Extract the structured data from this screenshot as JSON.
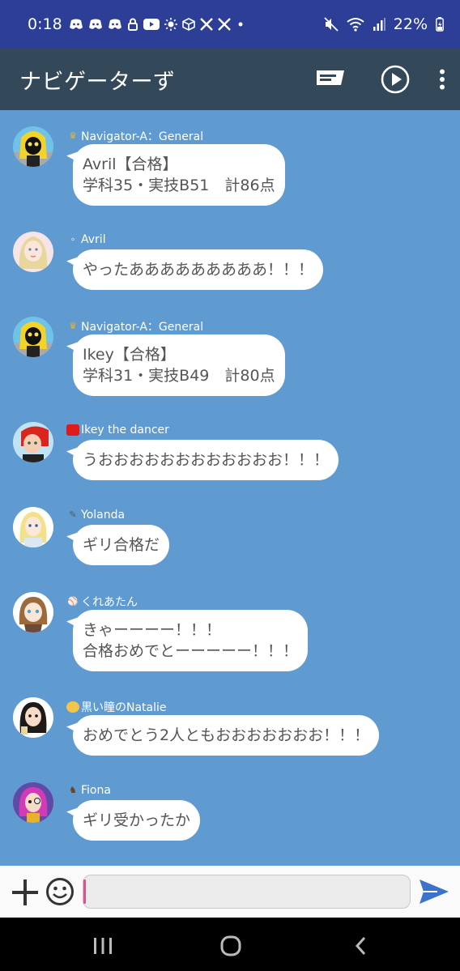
{
  "status_bar": {
    "time": "0:18",
    "battery": "22%",
    "icons": [
      "discord-icon",
      "discord-icon",
      "discord-icon",
      "lock-icon",
      "youtube-icon",
      "sun-icon",
      "cube-icon",
      "x-icon",
      "x-icon",
      "dot-icon",
      "mute-icon",
      "wifi-icon",
      "signal-icon",
      "battery-icon"
    ]
  },
  "app_bar": {
    "title": "ナビゲーターず",
    "actions": [
      "message-icon",
      "play-icon",
      "more-vert-icon"
    ]
  },
  "messages": [
    {
      "sender": "Navigator-A：General",
      "mark": "crown",
      "lines": [
        "Avril【合格】",
        "学科35・実技B51　計86点"
      ]
    },
    {
      "sender": "Avril",
      "mark": "bubbles",
      "lines": [
        "やったあああああああああ！！！"
      ]
    },
    {
      "sender": "Navigator-A：General",
      "mark": "crown",
      "lines": [
        "Ikey【合格】",
        "学科31・実技B49　計80点"
      ]
    },
    {
      "sender": "Ikey the dancer",
      "mark": "red-square",
      "lines": [
        "うおおおおおおおおおおおお！！！"
      ]
    },
    {
      "sender": "Yolanda",
      "mark": "feather",
      "lines": [
        "ギリ合格だ"
      ]
    },
    {
      "sender": "くれあたん",
      "mark": "baseball",
      "lines": [
        "きゃーーーー！！！",
        "合格おめでとーーーーー！！！"
      ]
    },
    {
      "sender": "黒い瞳のNatalie",
      "mark": "yellow-blob",
      "lines": [
        "おめでとう2人ともおおおおおおお！！！"
      ]
    },
    {
      "sender": "Fiona",
      "mark": "horse",
      "lines": [
        "ギリ受かったか"
      ]
    }
  ],
  "input": {
    "value": "",
    "placeholder": ""
  },
  "colors": {
    "status_bar": "#2d3e96",
    "app_bar": "#33495a",
    "chat_bg": "#5f9ad1",
    "send": "#3a73c9",
    "cursor": "#e0508a"
  }
}
